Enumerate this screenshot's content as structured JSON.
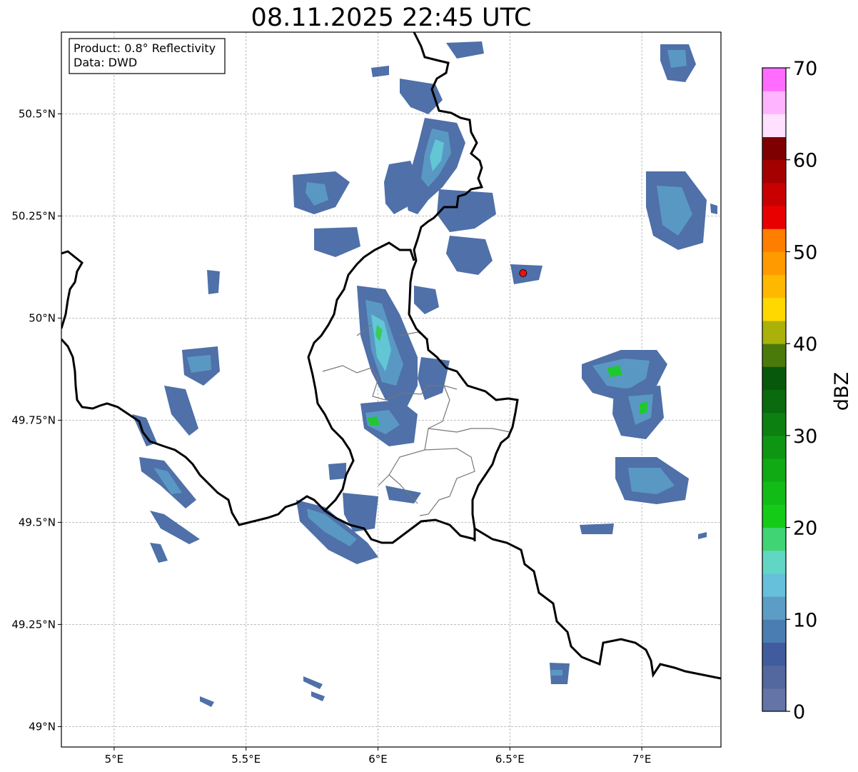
{
  "title": "08.11.2025 22:45 UTC",
  "info_box": {
    "product_line": "Product: 0.8° Reflectivity",
    "data_line": "Data: DWD"
  },
  "map": {
    "lon_range": [
      4.8,
      7.3
    ],
    "lat_range": [
      48.95,
      50.7
    ],
    "x_ticks": [
      {
        "value": 5.0,
        "label": "5°E"
      },
      {
        "value": 5.5,
        "label": "5.5°E"
      },
      {
        "value": 6.0,
        "label": "6°E"
      },
      {
        "value": 6.5,
        "label": "6.5°E"
      },
      {
        "value": 7.0,
        "label": "7°E"
      }
    ],
    "y_ticks": [
      {
        "value": 50.5,
        "label": "50.5°N"
      },
      {
        "value": 50.25,
        "label": "50.25°N"
      },
      {
        "value": 50.0,
        "label": "50°N"
      },
      {
        "value": 49.75,
        "label": "49.75°N"
      },
      {
        "value": 49.5,
        "label": "49.5°N"
      },
      {
        "value": 49.25,
        "label": "49.25°N"
      },
      {
        "value": 49.0,
        "label": "49°N"
      }
    ],
    "gridlines": true,
    "radar_site": {
      "lon": 6.55,
      "lat": 50.11,
      "color": "#ee1111"
    }
  },
  "colorbar": {
    "label": "dBZ",
    "min": 0,
    "max": 70,
    "step": 2.5,
    "tick_labels": [
      "0",
      "10",
      "20",
      "30",
      "40",
      "50",
      "60",
      "70"
    ],
    "colors": [
      "#6474a6",
      "#52689e",
      "#405c9e",
      "#4a7eb2",
      "#5c9dc6",
      "#66c0dc",
      "#62d6c4",
      "#40d474",
      "#14cc18",
      "#12bc16",
      "#10aa14",
      "#0e9612",
      "#0c8010",
      "#0a6a0e",
      "#08580c",
      "#4a7a0a",
      "#aab20a",
      "#ffd800",
      "#ffb800",
      "#ff9a00",
      "#ff7e00",
      "#e80000",
      "#c80000",
      "#a40000",
      "#7e0000",
      "#ffe0ff",
      "#ffb4ff",
      "#ff6cff",
      "#e83ce8"
    ]
  }
}
